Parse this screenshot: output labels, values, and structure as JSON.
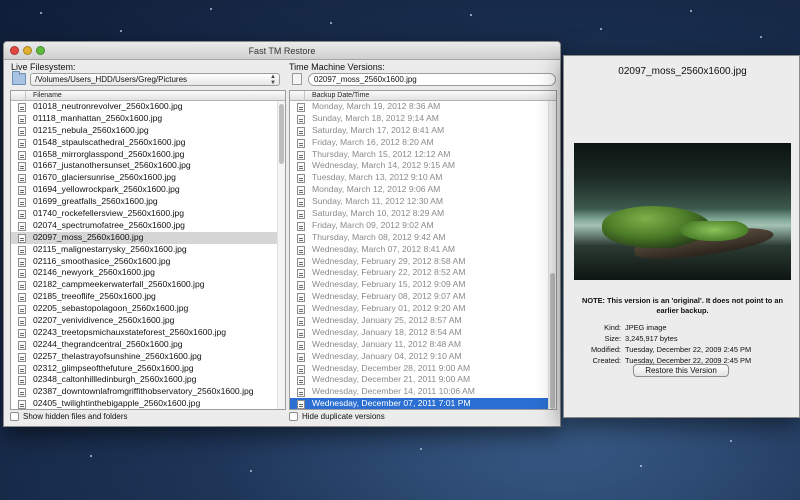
{
  "window": {
    "title": "Fast TM Restore"
  },
  "left_pane": {
    "label": "Live Filesystem:",
    "path": "/Volumes/Users_HDD/Users/Greg/Pictures",
    "column_header": "Filename",
    "files": [
      "01018_neutronrevolver_2560x1600.jpg",
      "01118_manhattan_2560x1600.jpg",
      "01215_nebula_2560x1600.jpg",
      "01548_stpaulscathedral_2560x1600.jpg",
      "01658_mirrorglasspond_2560x1600.jpg",
      "01667_justanothersunset_2560x1600.jpg",
      "01670_glaciersunrise_2560x1600.jpg",
      "01694_yellowrockpark_2560x1600.jpg",
      "01699_greatfalls_2560x1600.jpg",
      "01740_rockefellersview_2560x1600.jpg",
      "02074_spectrumofatree_2560x1600.jpg",
      "02097_moss_2560x1600.jpg",
      "02115_malignestarrysky_2560x1600.jpg",
      "02116_smoothasice_2560x1600.jpg",
      "02146_newyork_2560x1600.jpg",
      "02182_campmeekerwaterfall_2560x1600.jpg",
      "02185_treeoflife_2560x1600.jpg",
      "02205_sebastopolagoon_2560x1600.jpg",
      "02207_venividivence_2560x1600.jpg",
      "02243_treetopsmichauxstateforest_2560x1600.jpg",
      "02244_thegrandcentral_2560x1600.jpg",
      "02257_thelastrayofsunshine_2560x1600.jpg",
      "02312_glimpseofthefuture_2560x1600.jpg",
      "02348_caltonhillledinburgh_2560x1600.jpg",
      "02387_downtownlafromgriffithobservatory_2560x1600.jpg",
      "02405_twilightinthebigapple_2560x1600.jpg"
    ],
    "selected_index": 11,
    "show_hidden_label": "Show hidden files and folders"
  },
  "right_pane": {
    "label": "Time Machine Versions:",
    "current_file": "02097_moss_2560x1600.jpg",
    "column_header": "Backup Date/Time",
    "versions": [
      "Monday, March 19, 2012 8:36 AM",
      "Sunday, March 18, 2012 9:14 AM",
      "Saturday, March 17, 2012 8:41 AM",
      "Friday, March 16, 2012 8:20 AM",
      "Thursday, March 15, 2012 12:12 AM",
      "Wednesday, March 14, 2012 9:15 AM",
      "Tuesday, March 13, 2012 9:10 AM",
      "Monday, March 12, 2012 9:06 AM",
      "Sunday, March 11, 2012 12:30 AM",
      "Saturday, March 10, 2012 8:29 AM",
      "Friday, March 09, 2012 9:02 AM",
      "Thursday, March 08, 2012 9:42 AM",
      "Wednesday, March 07, 2012 8:41 AM",
      "Wednesday, February 29, 2012 8:58 AM",
      "Wednesday, February 22, 2012 8:52 AM",
      "Wednesday, February 15, 2012 9:09 AM",
      "Wednesday, February 08, 2012 9:07 AM",
      "Wednesday, February 01, 2012 9:20 AM",
      "Wednesday, January 25, 2012 8:57 AM",
      "Wednesday, January 18, 2012 8:54 AM",
      "Wednesday, January 11, 2012 8:48 AM",
      "Wednesday, January 04, 2012 9:10 AM",
      "Wednesday, December 28, 2011 9:00 AM",
      "Wednesday, December 21, 2011 9:00 AM",
      "Wednesday, December 14, 2011 10:06 AM",
      "Wednesday, December 07, 2011 7:01 PM"
    ],
    "selected_index": 25,
    "hide_duplicates_label": "Hide duplicate versions"
  },
  "detail": {
    "title": "02097_moss_2560x1600.jpg",
    "note": "NOTE: This version is an 'original'.  It does not point to an earlier backup.",
    "kind_label": "Kind:",
    "kind_value": "JPEG image",
    "size_label": "Size:",
    "size_value": "3,245,917 bytes",
    "modified_label": "Modified:",
    "modified_value": "Tuesday, December 22, 2009 2:45 PM",
    "created_label": "Created:",
    "created_value": "Tuesday, December 22, 2009 2:45 PM",
    "restore_button": "Restore this Version"
  },
  "colors": {
    "selection_blue": "#2a6fd1",
    "selection_gray": "#d6d6d6",
    "dim_text": "#8a8a8a"
  }
}
